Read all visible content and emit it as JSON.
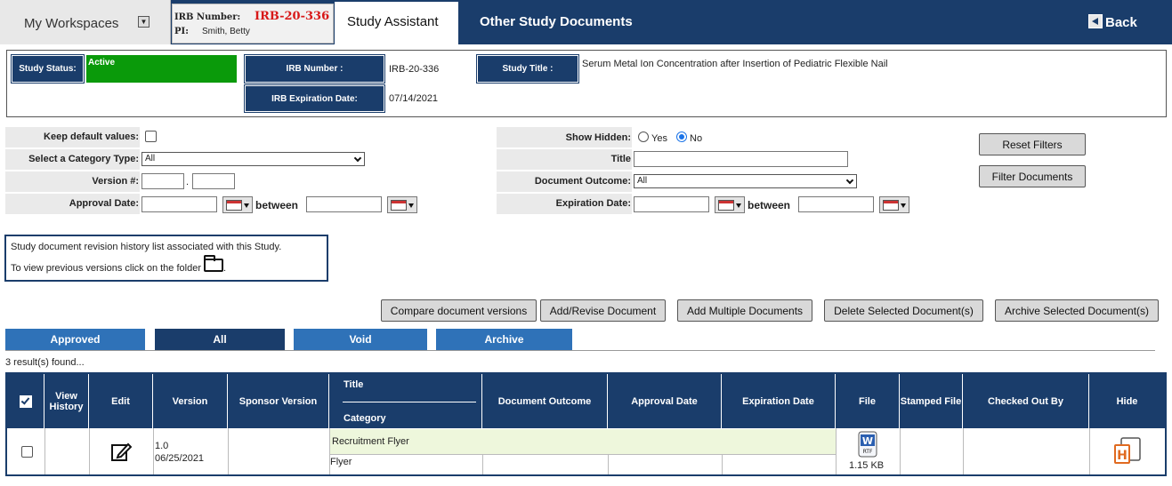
{
  "header": {
    "workspaces_label": "My Workspaces",
    "dropdown_glyph": "▼",
    "irb_number_label": "IRB Number:",
    "irb_number_value": "IRB-20-336",
    "pi_label": "PI:",
    "pi_value": "Smith, Betty",
    "tab_study_assistant": "Study Assistant",
    "tab_other_docs": "Other Study Documents",
    "back_label": "Back"
  },
  "study": {
    "status_label": "Study Status:",
    "status_value": "Active",
    "irb_number_label": "IRB Number :",
    "irb_number_value": "IRB-20-336",
    "expiration_label": "IRB Expiration Date:",
    "expiration_value": "07/14/2021",
    "title_label": "Study Title :",
    "title_value": "Serum Metal Ion Concentration after Insertion of Pediatric Flexible Nail",
    "status_color": "#0a9a0a"
  },
  "filters": {
    "keep_default_label": "Keep default values:",
    "category_type_label": "Select a Category Type:",
    "category_type_value": "All",
    "version_label": "Version #:",
    "version_sep": ".",
    "approval_date_label": "Approval Date:",
    "between_label": "between",
    "show_hidden_label": "Show Hidden:",
    "show_hidden_yes": "Yes",
    "show_hidden_no": "No",
    "title_label": "Title",
    "document_outcome_label": "Document Outcome:",
    "document_outcome_value": "All",
    "expiration_date_label": "Expiration Date:",
    "reset_button": "Reset Filters",
    "filter_button": "Filter Documents"
  },
  "info": {
    "line1": "Study document revision history list associated with this Study.",
    "line2": "To view previous versions click on the folder",
    "line2_end": "."
  },
  "actions": {
    "compare": "Compare document versions",
    "add_revise": "Add/Revise Document",
    "add_multiple": "Add Multiple Documents",
    "delete_selected": "Delete Selected Document(s)",
    "archive_selected": "Archive Selected Document(s)"
  },
  "view_tabs": {
    "approved": "Approved",
    "all": "All",
    "void": "Void",
    "archive": "Archive",
    "active_color": "#1a3d6b",
    "inactive_color": "#2f72b8"
  },
  "results_text": "3 result(s) found...",
  "table": {
    "columns": {
      "view_history": "View History",
      "edit": "Edit",
      "version": "Version",
      "sponsor_version": "Sponsor Version",
      "title": "Title",
      "category": "Category",
      "document_outcome": "Document Outcome",
      "approval_date": "Approval Date",
      "expiration_date": "Expiration Date",
      "file": "File",
      "stamped_file": "Stamped File",
      "checked_out_by": "Checked Out By",
      "hide": "Hide"
    },
    "rows": [
      {
        "version": "1.0",
        "version_date": "06/25/2021",
        "title": "Recruitment Flyer",
        "category": "Flyer",
        "file_type": "RTF",
        "file_size": "1.15 KB"
      }
    ]
  },
  "icons": {
    "edit": "edit-icon",
    "file": "rtf-file-icon",
    "hide": "hide-icon",
    "folder": "folder-icon"
  }
}
